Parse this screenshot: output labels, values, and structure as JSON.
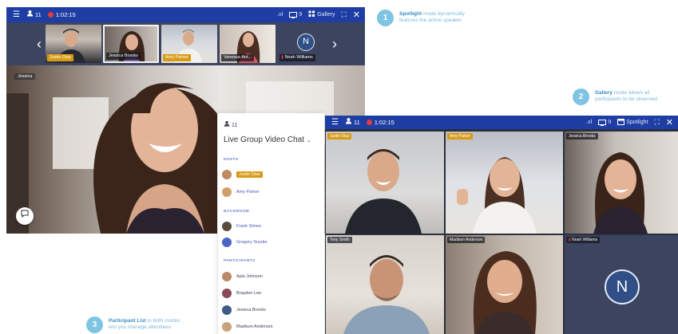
{
  "callouts": [
    {
      "number": "1",
      "bold": "Spotlight",
      "line1_rest": " mode dynamically",
      "line2": "features the active speaker"
    },
    {
      "number": "2",
      "bold": "Gallery",
      "line1_rest": " mode allows all",
      "line2": "participants to be observed"
    },
    {
      "number": "3",
      "bold": "Participant List",
      "line1_rest": " in both modes",
      "line2": "lets you manage attendees"
    }
  ],
  "spotlight_window": {
    "participant_count": "11",
    "timer": "1:02:15",
    "signal": ".ııl",
    "screens_count": "9",
    "view_label": "Gallery",
    "thumbnails": [
      {
        "name": "Justin Diaz",
        "highlight": true
      },
      {
        "name": "Jessica Brooks",
        "highlight": false
      },
      {
        "name": "Amy Parker",
        "highlight": true
      },
      {
        "name": "Vanessa Ant...",
        "highlight": false
      },
      {
        "name": "Noah Williams",
        "highlight": false
      }
    ],
    "avatar_letter": "N",
    "speaker_label": "Jessica",
    "prev_arrow": "‹",
    "next_arrow": "›"
  },
  "participant_list": {
    "count": "11",
    "title": "Live Group Video Chat",
    "sections": {
      "hosts": "HOSTS",
      "backroom": "BACKROOM",
      "participants": "PARTICIPANTS"
    },
    "hosts": [
      {
        "name": "Justin Diaz",
        "highlight": true
      },
      {
        "name": "Amy Parker",
        "highlight": false
      }
    ],
    "backroom": [
      {
        "name": "Frank Simon"
      },
      {
        "name": "Gregory Snyder"
      }
    ],
    "participants": [
      {
        "name": "Ayla Johnson"
      },
      {
        "name": "Brayden Lee"
      },
      {
        "name": "Jessica Brooks"
      },
      {
        "name": "Madison Anderson"
      }
    ]
  },
  "gallery_window": {
    "participant_count": "11",
    "timer": "1:02:15",
    "signal": ".ııl",
    "screens_count": "9",
    "view_label": "Spotlight",
    "tiles": [
      {
        "name": "Justin Diaz",
        "highlight": true
      },
      {
        "name": "Amy Parker",
        "highlight": true
      },
      {
        "name": "Jessica Brooks",
        "highlight": false
      },
      {
        "name": "Tony Smith",
        "highlight": false
      },
      {
        "name": "Madison Anderson",
        "highlight": false
      },
      {
        "name": "Noah Williams",
        "highlight": false
      }
    ],
    "avatar_letter": "N"
  },
  "colors": {
    "topbar": "#1f3ea4",
    "highlight_gold": "#d89b16",
    "callout_blue": "#7fc4e3",
    "record_red": "#e23b3b"
  }
}
